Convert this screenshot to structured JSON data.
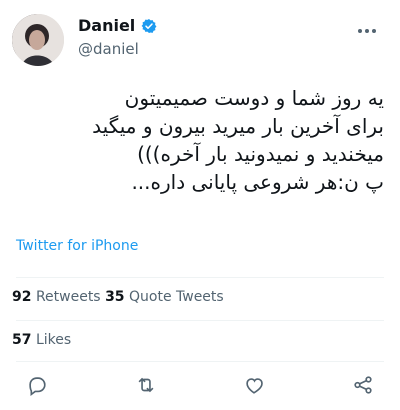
{
  "tweet": {
    "author": {
      "name": "Daniel",
      "handle": "@daniel",
      "verified_color": "#1d9bf0"
    },
    "text": "یه روز شما و دوست صمیمیتون\nبرای آخرین بار میرید بیرون و میگید\nمیخندید و نمیدونید بار آخره)))\nپ ن:هر شروعی پایانی داره...",
    "source": "Twitter for iPhone",
    "stats": {
      "retweets_count": "92",
      "retweets_label": "Retweets",
      "quote_count": "35",
      "quote_label": "Quote Tweets",
      "likes_count": "57",
      "likes_label": "Likes"
    },
    "actions": [
      "reply-icon",
      "retweet-icon",
      "like-icon",
      "share-icon"
    ],
    "colors": {
      "link": "#1d9bf0",
      "muted": "#536471",
      "text": "#0f1419"
    }
  }
}
